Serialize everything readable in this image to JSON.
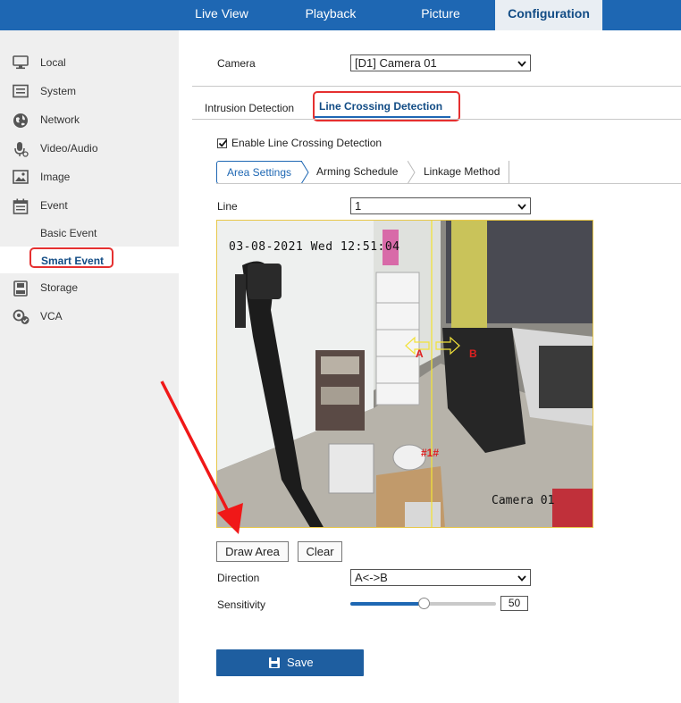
{
  "nav": {
    "tabs": [
      {
        "label": "Live View"
      },
      {
        "label": "Playback"
      },
      {
        "label": "Picture"
      },
      {
        "label": "Configuration"
      }
    ],
    "active_tab": "Configuration"
  },
  "sidebar": {
    "items": [
      {
        "label": "Local",
        "icon": "monitor-icon"
      },
      {
        "label": "System",
        "icon": "system-icon"
      },
      {
        "label": "Network",
        "icon": "globe-icon"
      },
      {
        "label": "Video/Audio",
        "icon": "microphone-icon"
      },
      {
        "label": "Image",
        "icon": "image-icon"
      },
      {
        "label": "Event",
        "icon": "calendar-icon"
      },
      {
        "label": "Storage",
        "icon": "storage-icon"
      },
      {
        "label": "VCA",
        "icon": "vca-icon"
      }
    ],
    "sub_items": [
      {
        "label": "Basic Event"
      },
      {
        "label": "Smart Event"
      }
    ]
  },
  "main": {
    "camera_label": "Camera",
    "camera_value": "[D1] Camera 01",
    "detection_tabs": [
      {
        "label": "Intrusion Detection"
      },
      {
        "label": "Line Crossing Detection"
      }
    ],
    "enable_label": "Enable Line Crossing Detection",
    "enable_checked": true,
    "sub_tabs": [
      {
        "label": "Area Settings"
      },
      {
        "label": "Arming Schedule"
      },
      {
        "label": "Linkage Method"
      }
    ],
    "line_label": "Line",
    "line_value": "1",
    "video": {
      "timestamp": "03-08-2021 Wed 12:51:04",
      "camera_name": "Camera 01",
      "marker_a": "A",
      "marker_b": "B",
      "line_tag": "#1#"
    },
    "draw_area_label": "Draw Area",
    "clear_label": "Clear",
    "direction_label": "Direction",
    "direction_value": "A<->B",
    "sensitivity_label": "Sensitivity",
    "sensitivity_value": "50",
    "sensitivity_fraction": 0.5,
    "save_label": "Save"
  },
  "colors": {
    "nav_bg": "#1e67b3",
    "active_text": "#124c85",
    "highlight_red": "#e53030",
    "save_bg": "#1e5ea0",
    "detection_line": "#f2e23a"
  }
}
